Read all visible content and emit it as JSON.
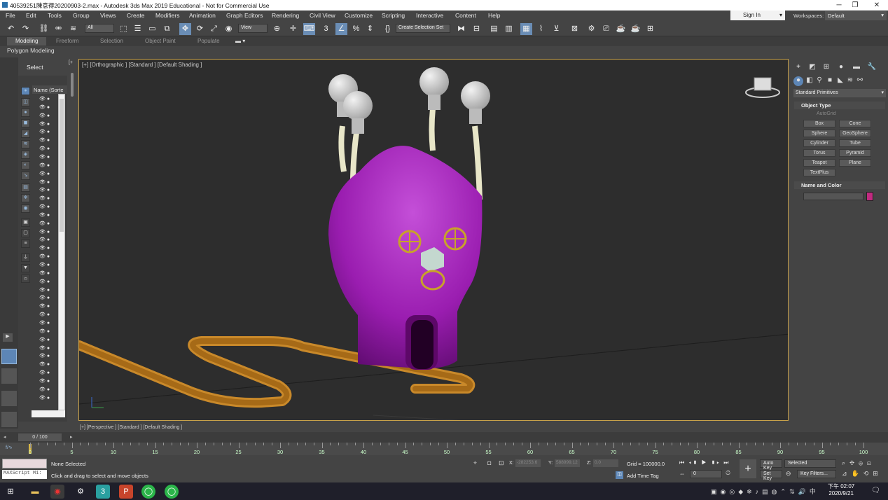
{
  "window": {
    "title": "40539251陳意得20200903-2.max - Autodesk 3ds Max 2019 Educational - Not for Commercial Use",
    "min": "─",
    "max": "❐",
    "close": "✕"
  },
  "menu": [
    "File",
    "Edit",
    "Tools",
    "Group",
    "Views",
    "Create",
    "Modifiers",
    "Animation",
    "Graph Editors",
    "Rendering",
    "Civil View",
    "Customize",
    "Scripting",
    "Interactive",
    "Content",
    "Help"
  ],
  "signin": "Sign In",
  "workspaces_label": "Workspaces:",
  "workspace": "Default",
  "toolbar": {
    "filter": "All",
    "view": "View",
    "selection_set": "Create Selection Set"
  },
  "ribbon": {
    "tabs": [
      "Modeling",
      "Freeform",
      "Selection",
      "Object Paint",
      "Populate"
    ],
    "sub": "Polygon Modeling"
  },
  "scene_explorer": {
    "title": "Select",
    "name_col": "Name (Sorte",
    "frame_box": "0 / 100"
  },
  "viewport": {
    "label": "[+] [Orthographic ] [Standard ] [Default Shading ]",
    "label2": "[+] [Perspective ] [Standard ] [Default Shading ]"
  },
  "command_panel": {
    "category": "Standard Primitives",
    "object_type": "Object Type",
    "autogrid": "AutoGrid",
    "buttons": [
      "Box",
      "Cone",
      "Sphere",
      "GeoSphere",
      "Cylinder",
      "Tube",
      "Torus",
      "Pyramid",
      "Teapot",
      "Plane",
      "TextPlus"
    ],
    "name_and_color": "Name and Color",
    "color": "#c12a80"
  },
  "timeline": {
    "ticks": [
      "0",
      "5",
      "10",
      "15",
      "20",
      "25",
      "30",
      "35",
      "40",
      "45",
      "50",
      "55",
      "60",
      "65",
      "70",
      "75",
      "80",
      "85",
      "90",
      "95",
      "100"
    ]
  },
  "status": {
    "none_selected": "None Selected",
    "hint": "Click and drag to select and move objects",
    "maxscript": "MAXScript Mi:",
    "x_label": "X:",
    "x_val": "-282253.6",
    "y_label": "Y:",
    "y_val": "588999.12",
    "z_label": "Z:",
    "z_val": "0.0",
    "grid": "Grid = 100000.0",
    "add_time_tag": "Add Time Tag",
    "auto_key": "Auto Key",
    "set_key": "Set Key",
    "selected": "Selected",
    "key_filters": "Key Filters...",
    "frame": "0"
  },
  "taskbar": {
    "time": "下午 02:07",
    "date": "2020/9/21"
  }
}
